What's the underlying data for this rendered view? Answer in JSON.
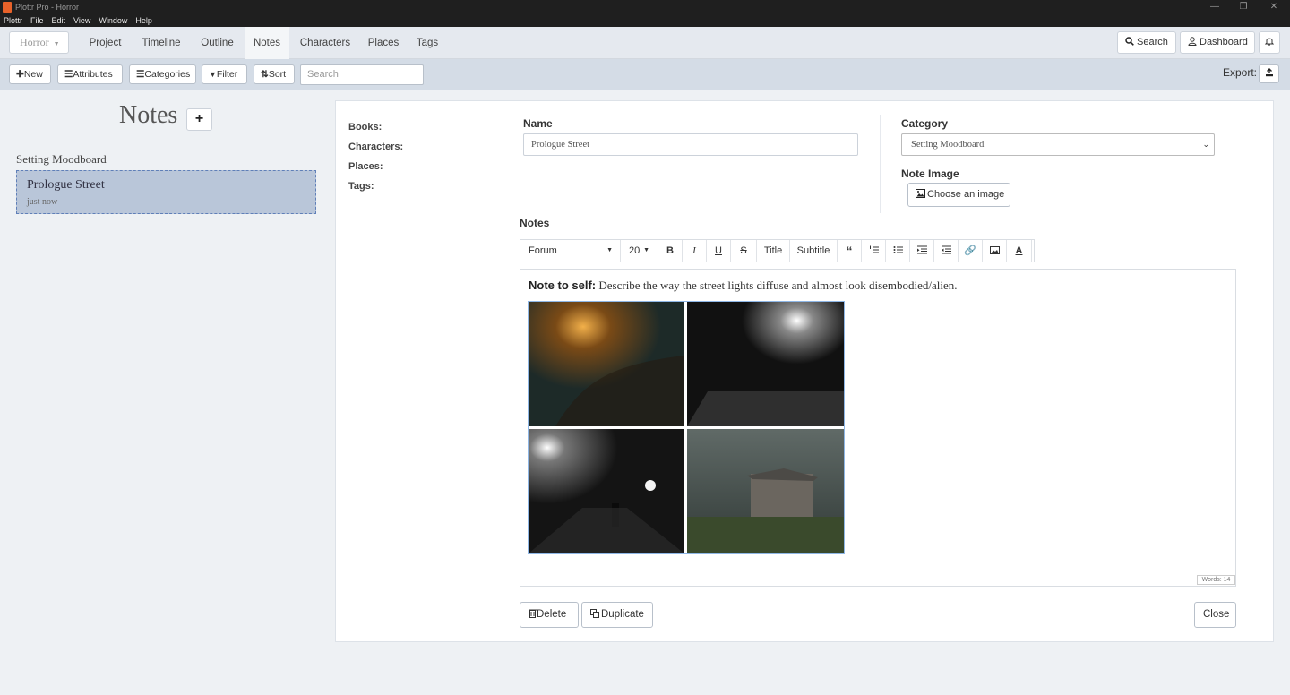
{
  "window": {
    "title": "Plottr Pro - Horror",
    "controls": [
      "minimize",
      "restore",
      "close"
    ]
  },
  "menubar": [
    "Plottr",
    "File",
    "Edit",
    "View",
    "Window",
    "Help"
  ],
  "nav": {
    "book_selector": "Horror",
    "tabs": [
      "Project",
      "Timeline",
      "Outline",
      "Notes",
      "Characters",
      "Places",
      "Tags"
    ],
    "active_tab": "Notes",
    "search_label": "Search",
    "dashboard_label": "Dashboard"
  },
  "toolbar": {
    "new_label": "New",
    "attributes_label": "Attributes",
    "categories_label": "Categories",
    "filter_label": "Filter",
    "sort_label": "Sort",
    "search_placeholder": "Search",
    "export_label": "Export:"
  },
  "sidebar": {
    "heading": "Notes",
    "add_label": "+",
    "category": "Setting Moodboard",
    "notes": [
      {
        "title": "Prologue Street",
        "time": "just now"
      }
    ]
  },
  "detail": {
    "meta_labels": [
      "Books:",
      "Characters:",
      "Places:",
      "Tags:"
    ],
    "name_label": "Name",
    "name_value": "Prologue Street",
    "category_label": "Category",
    "category_value": "Setting Moodboard",
    "note_image_label": "Note Image",
    "choose_image_label": "Choose an image",
    "notes_label": "Notes",
    "editor_toolbar": {
      "font": "Forum",
      "size": "20",
      "title_btn": "Title",
      "subtitle_btn": "Subtitle"
    },
    "note_prefix": "Note to self:",
    "note_text": " Describe the way the street lights diffuse and almost look disembodied/alien.",
    "word_count": "Words: 14",
    "delete_label": "Delete",
    "duplicate_label": "Duplicate",
    "close_label": "Close"
  },
  "colors": {
    "selected_note": "#b9c6d9",
    "selected_border": "#5f7fb8",
    "app_icon": "#e8622a"
  }
}
